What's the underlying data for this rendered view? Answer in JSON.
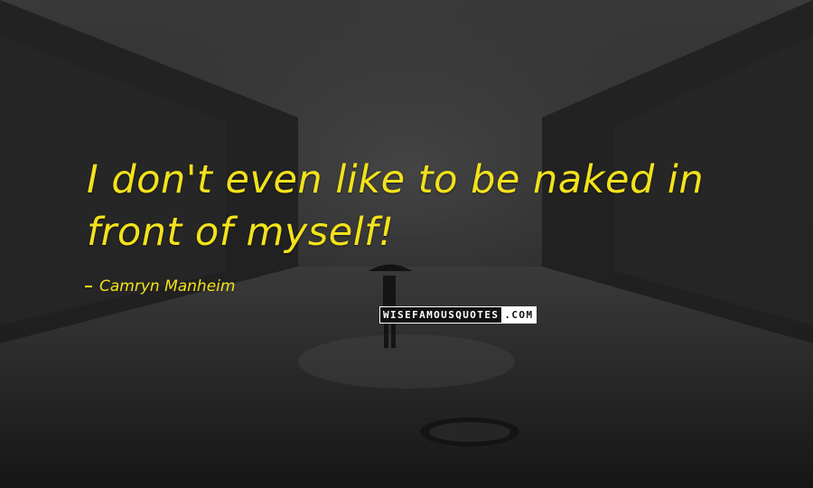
{
  "quote": {
    "line1": "I don't even like to be naked in",
    "line2": "front of myself!"
  },
  "author": {
    "name": "Camryn Manheim"
  },
  "watermark": {
    "part1": "WISEFAMOUSQUOTES",
    "part2": ".COM"
  },
  "colors": {
    "quote_text": "#f3e21b",
    "background": "#2a2a2a"
  }
}
